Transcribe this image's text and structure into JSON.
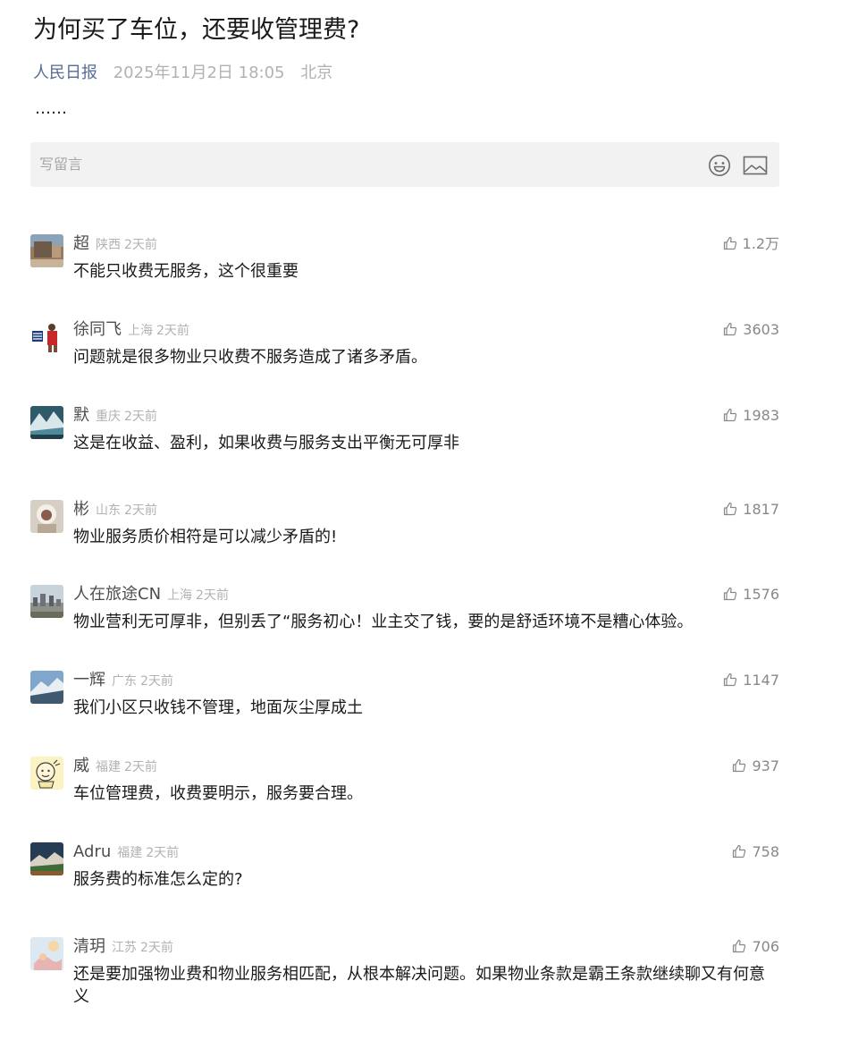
{
  "article": {
    "title": "为何买了车位，还要收管理费?",
    "source": "人民日报",
    "date": "2025年11月2日 18:05",
    "location": "北京",
    "excerpt": "……"
  },
  "comment_input": {
    "placeholder": "写留言",
    "emoji_icon": "smiley-face-icon",
    "image_icon": "image-icon"
  },
  "colors": {
    "source_link": "#576b95",
    "muted": "#b2b2b2",
    "input_bg": "#f2f2f2"
  },
  "comments": [
    {
      "name": "超",
      "region": "陕西",
      "time": "2天前",
      "likes": "1.2万",
      "text": "不能只收费无服务，这个很重要"
    },
    {
      "name": "徐同飞",
      "region": "上海",
      "time": "2天前",
      "likes": "3603",
      "text": "问题就是很多物业只收费不服务造成了诸多矛盾。"
    },
    {
      "name": "默",
      "region": "重庆",
      "time": "2天前",
      "likes": "1983",
      "text": "这是在收益、盈利，如果收费与服务支出平衡无可厚非"
    },
    {
      "name": "彬",
      "region": "山东",
      "time": "2天前",
      "likes": "1817",
      "text": "物业服务质价相符是可以减少矛盾的!"
    },
    {
      "name": "人在旅途CN",
      "region": "上海",
      "time": "2天前",
      "likes": "1576",
      "text": "物业营利无可厚非，但别丢了“服务初心！业主交了钱，要的是舒适环境不是糟心体验。"
    },
    {
      "name": "一辉",
      "region": "广东",
      "time": "2天前",
      "likes": "1147",
      "text": "我们小区只收钱不管理，地面灰尘厚成土"
    },
    {
      "name": "威",
      "region": "福建",
      "time": "2天前",
      "likes": "937",
      "text": "车位管理费，收费要明示，服务要合理。"
    },
    {
      "name": "Adru",
      "region": "福建",
      "time": "2天前",
      "likes": "758",
      "text": "服务费的标准怎么定的?"
    },
    {
      "name": "清玥",
      "region": "江苏",
      "time": "2天前",
      "likes": "706",
      "text": "还是要加强物业费和物业服务相匹配，从根本解决问题。如果物业条款是霸王条款继续聊又有何意义"
    }
  ]
}
